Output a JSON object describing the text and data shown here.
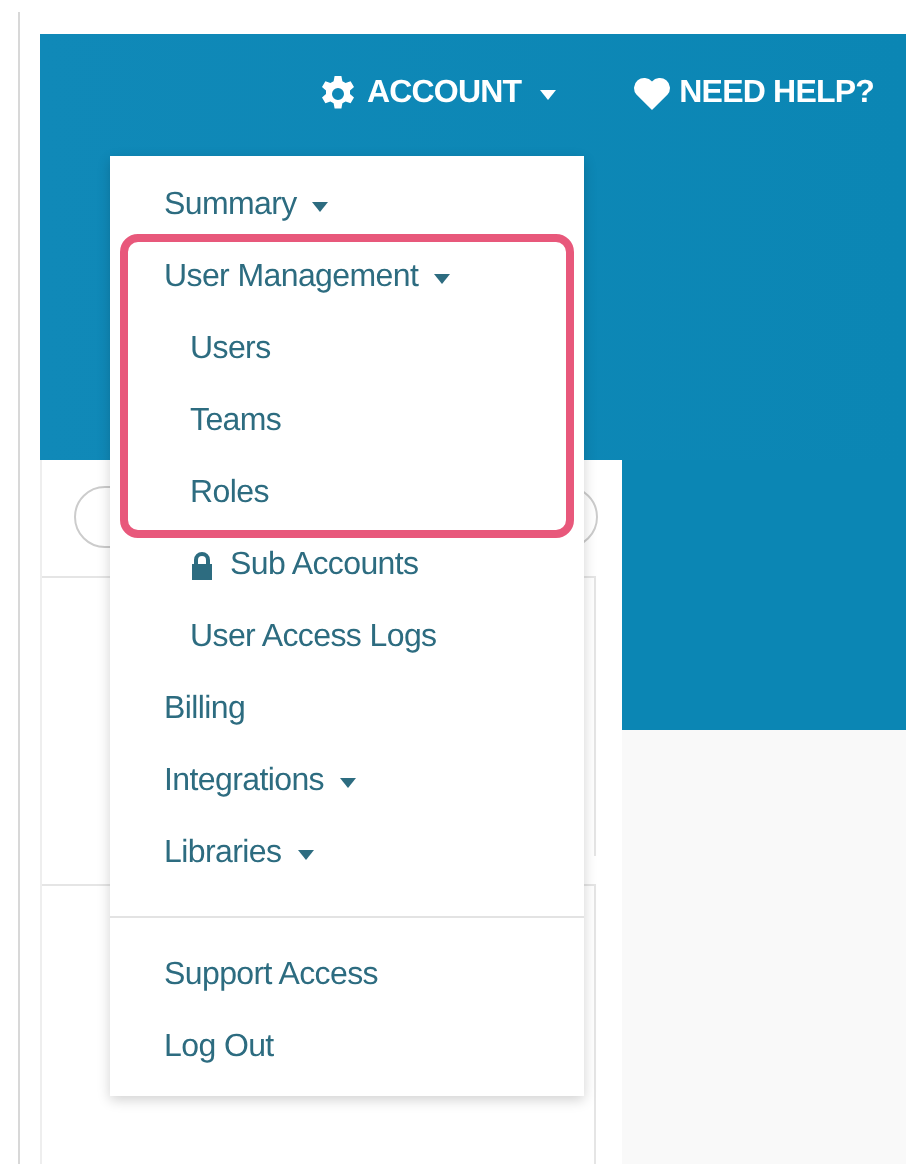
{
  "header": {
    "nav": [
      {
        "kind": "account",
        "label": "ACCOUNT",
        "dropdown": true
      },
      {
        "kind": "help",
        "label": "NEED HELP?",
        "dropdown": false
      }
    ]
  },
  "menu": {
    "sections": [
      {
        "items": [
          {
            "label": "Summary",
            "dropdown": true,
            "highlighted": false
          },
          {
            "label": "User Management",
            "dropdown": true,
            "highlighted": true,
            "children": [
              {
                "label": "Users",
                "locked": false,
                "highlighted": true
              },
              {
                "label": "Teams",
                "locked": false,
                "highlighted": true
              },
              {
                "label": "Roles",
                "locked": false,
                "highlighted": true
              },
              {
                "label": "Sub Accounts",
                "locked": true,
                "highlighted": false
              },
              {
                "label": "User Access Logs",
                "locked": false,
                "highlighted": false
              }
            ]
          },
          {
            "label": "Billing",
            "dropdown": false,
            "highlighted": false
          },
          {
            "label": "Integrations",
            "dropdown": true,
            "highlighted": false
          },
          {
            "label": "Libraries",
            "dropdown": true,
            "highlighted": false
          }
        ]
      },
      {
        "items": [
          {
            "label": "Support Access",
            "dropdown": false,
            "highlighted": false
          },
          {
            "label": "Log Out",
            "dropdown": false,
            "highlighted": false
          }
        ]
      }
    ]
  }
}
